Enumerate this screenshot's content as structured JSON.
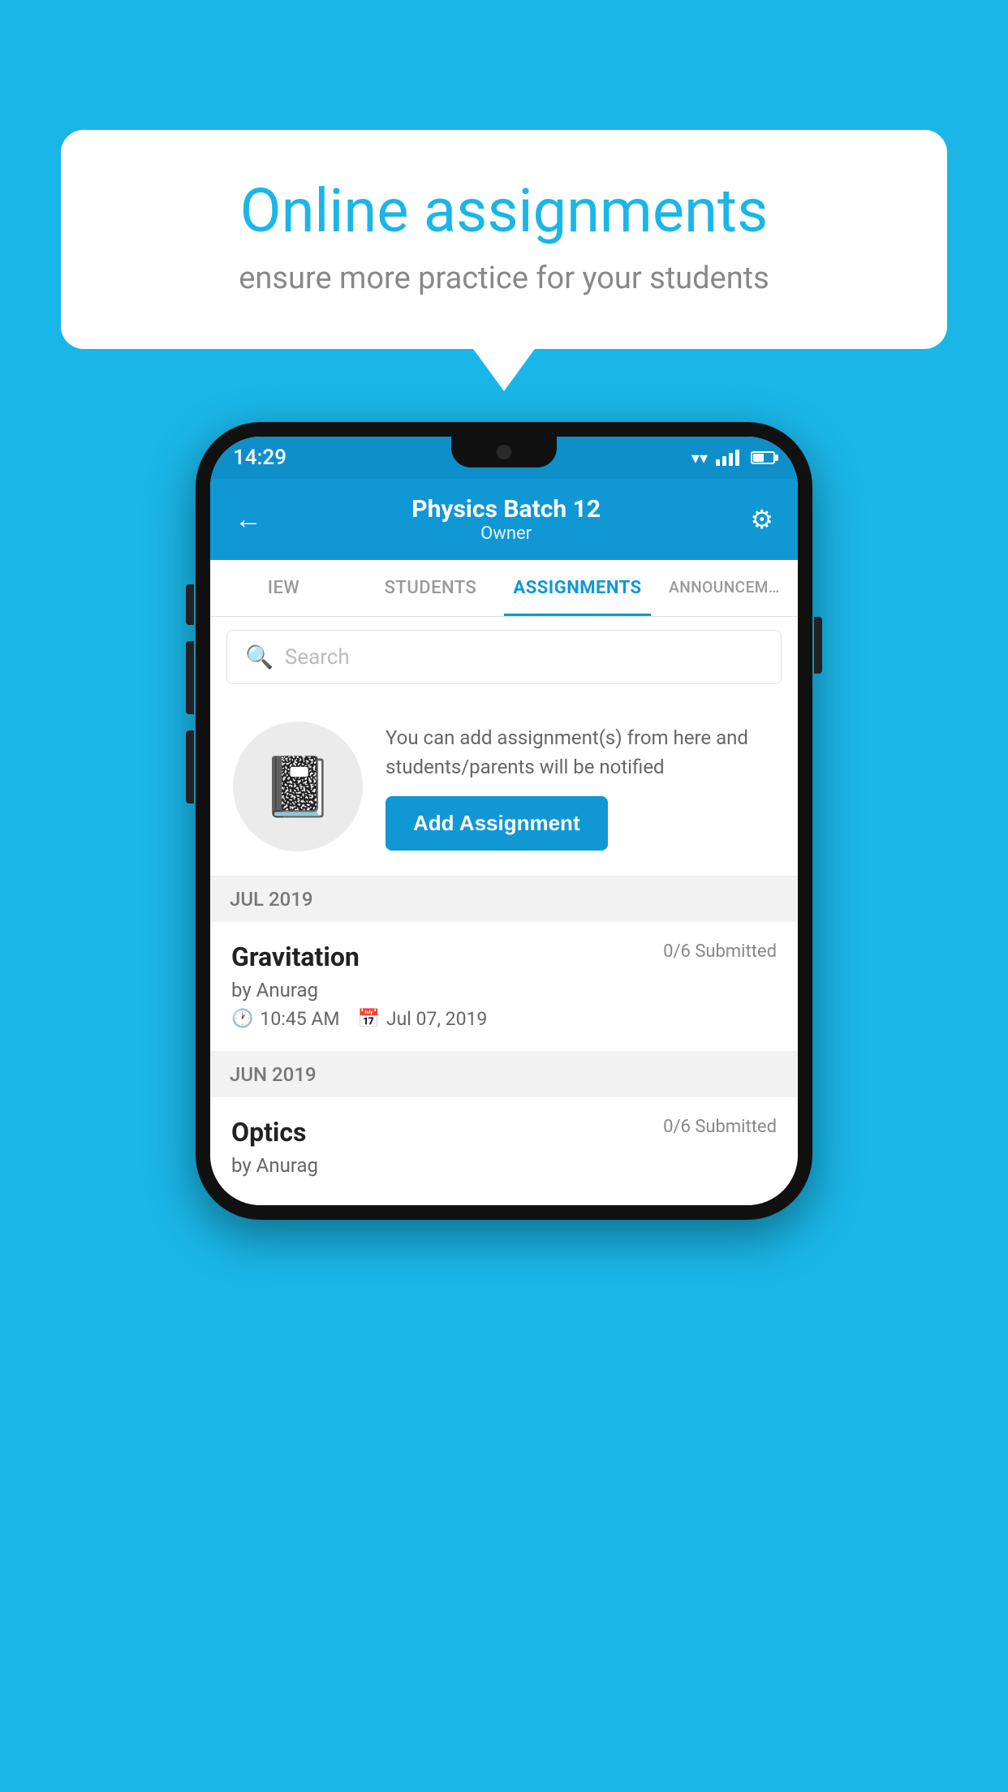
{
  "background_color": "#1ab6e8",
  "speech_bubble": {
    "title": "Online assignments",
    "subtitle": "ensure more practice for your students"
  },
  "phone": {
    "status_bar": {
      "time": "14:29"
    },
    "header": {
      "title": "Physics Batch 12",
      "subtitle": "Owner",
      "back_label": "←",
      "settings_label": "⚙"
    },
    "tabs": [
      {
        "label": "IEW",
        "active": false
      },
      {
        "label": "STUDENTS",
        "active": false
      },
      {
        "label": "ASSIGNMENTS",
        "active": true
      },
      {
        "label": "ANNOUNCEM…",
        "active": false
      }
    ],
    "search": {
      "placeholder": "Search"
    },
    "promo": {
      "description": "You can add assignment(s) from here and students/parents will be notified",
      "button_label": "Add Assignment"
    },
    "sections": [
      {
        "month": "JUL 2019",
        "assignments": [
          {
            "name": "Gravitation",
            "submitted": "0/6 Submitted",
            "by": "by Anurag",
            "time": "10:45 AM",
            "date": "Jul 07, 2019"
          }
        ]
      },
      {
        "month": "JUN 2019",
        "assignments": [
          {
            "name": "Optics",
            "submitted": "0/6 Submitted",
            "by": "by Anurag",
            "time": "",
            "date": ""
          }
        ]
      }
    ]
  }
}
